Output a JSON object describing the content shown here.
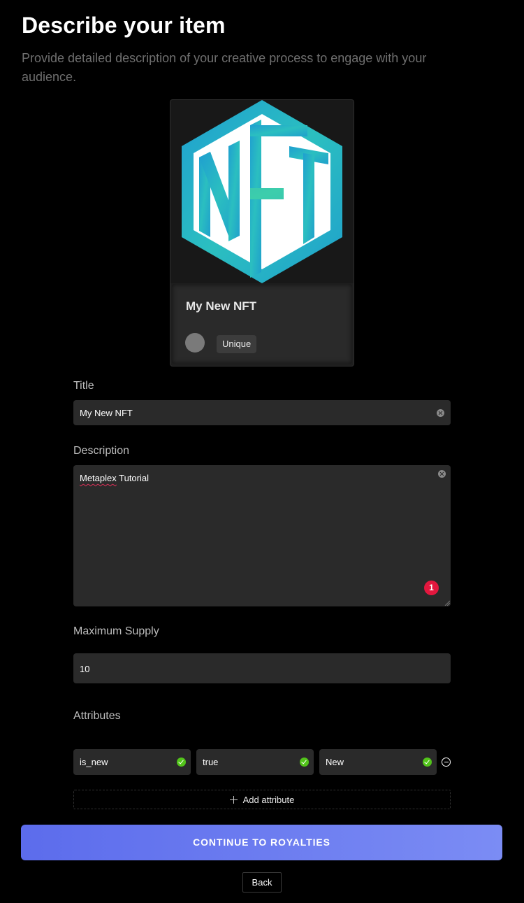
{
  "header": {
    "title": "Describe your item",
    "subtitle": "Provide detailed description of your creative process to engage with your audience."
  },
  "preview": {
    "logo_icon": "nft-hexagon-logo",
    "logo_text": "NFT",
    "title": "My New NFT",
    "badge": "Unique"
  },
  "form": {
    "title_label": "Title",
    "title_value": "My New NFT",
    "description_label": "Description",
    "description_word1": "Metaplex",
    "description_word2": " Tutorial",
    "description_badge": "1",
    "supply_label": "Maximum Supply",
    "supply_value": "10",
    "attributes_label": "Attributes",
    "attributes": [
      {
        "trait_type": "is_new",
        "value": "true",
        "display_type": "New"
      }
    ],
    "add_attribute_label": "Add attribute"
  },
  "actions": {
    "continue_label": "CONTINUE TO ROYALTIES",
    "back_label": "Back"
  },
  "colors": {
    "accent_start": "#5c6cec",
    "accent_end": "#7b8cf4",
    "valid": "#52c41a",
    "error_badge": "#e3173e"
  }
}
